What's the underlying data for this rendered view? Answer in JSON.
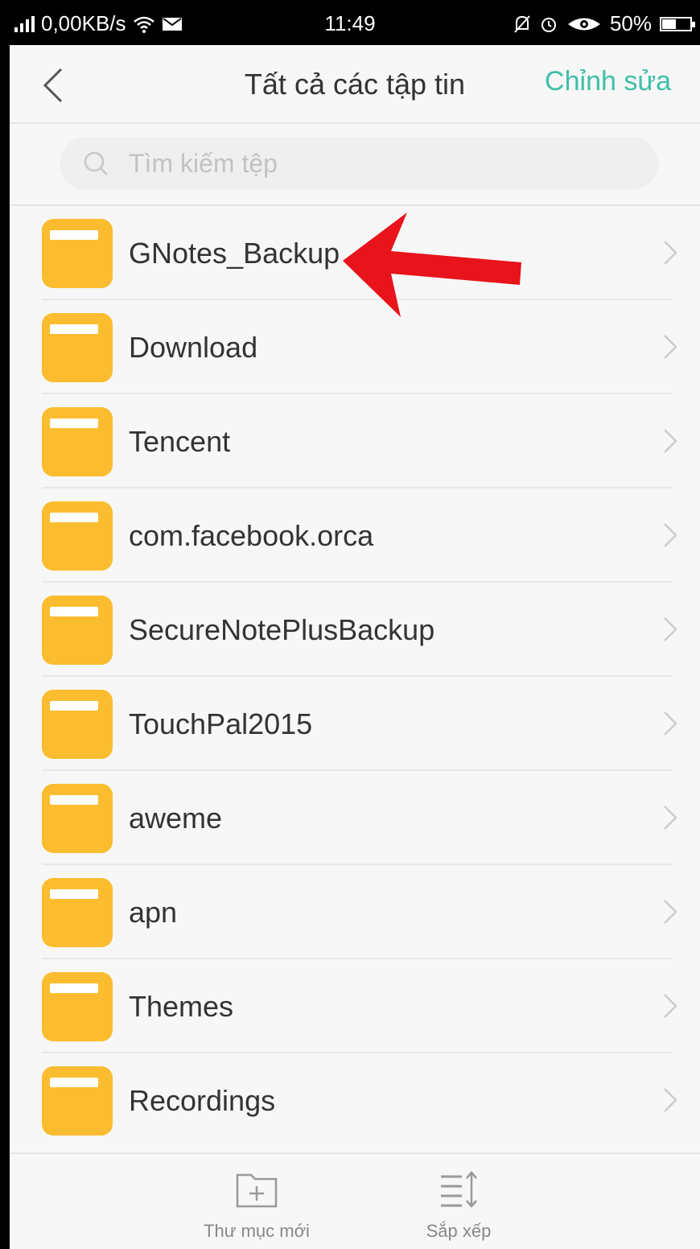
{
  "status_bar": {
    "network_speed": "0,00KB/s",
    "time": "11:49",
    "battery": "50%",
    "battery_level": 0.5
  },
  "header": {
    "title": "Tất cả các tập tin",
    "edit_label": "Chỉnh sửa"
  },
  "search": {
    "placeholder": "Tìm kiếm tệp"
  },
  "folders": [
    {
      "name": "GNotes_Backup"
    },
    {
      "name": "Download"
    },
    {
      "name": "Tencent"
    },
    {
      "name": "com.facebook.orca"
    },
    {
      "name": "SecureNotePlusBackup"
    },
    {
      "name": "TouchPal2015"
    },
    {
      "name": "aweme"
    },
    {
      "name": "apn"
    },
    {
      "name": "Themes"
    },
    {
      "name": "Recordings"
    }
  ],
  "bottom_bar": {
    "new_folder_label": "Thư mục mới",
    "sort_label": "Sắp xếp"
  },
  "colors": {
    "accent": "#3fbfa8",
    "folder": "#fbbd2f",
    "annotation_arrow": "#e8131b"
  }
}
